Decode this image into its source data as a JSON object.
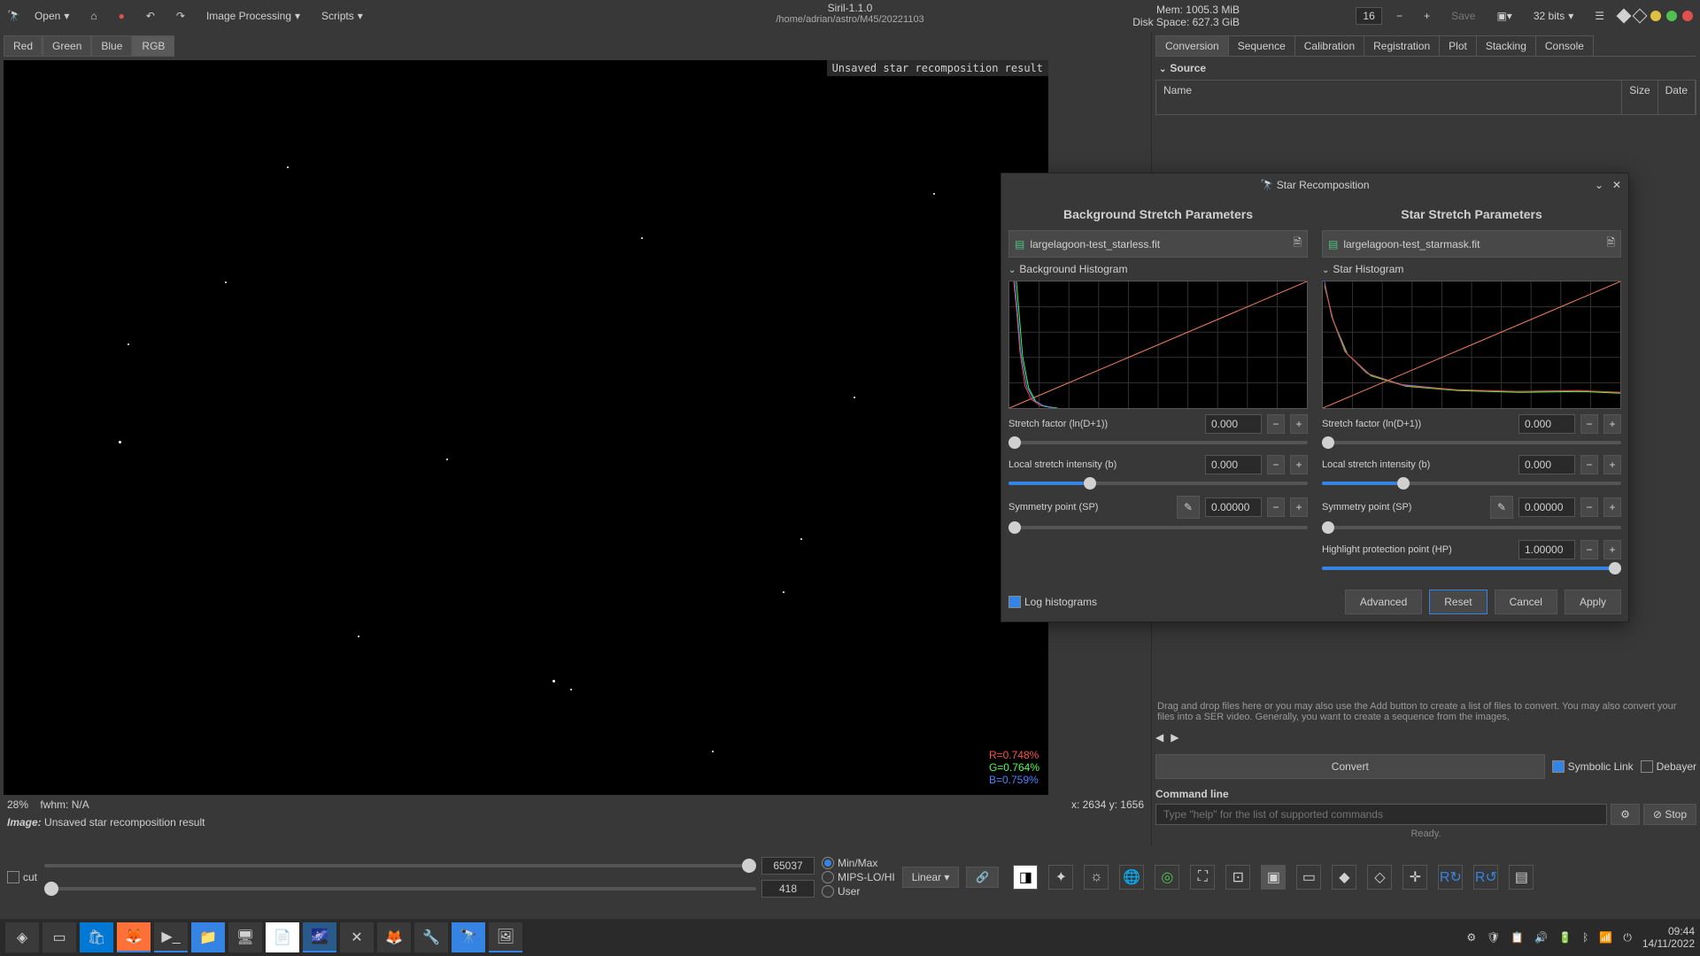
{
  "app": {
    "title": "Siril-1.1.0",
    "path": "/home/adrian/astro/M45/20221103"
  },
  "menu": {
    "open": "Open",
    "img_proc": "Image Processing",
    "scripts": "Scripts",
    "save": "Save",
    "bits": "32 bits"
  },
  "mem": {
    "line1": "Mem: 1005.3 MiB",
    "line2": "Disk Space: 627.3 GiB"
  },
  "toolbar_num": "16",
  "channels": [
    "Red",
    "Green",
    "Blue",
    "RGB"
  ],
  "channel_active": 3,
  "image_header": "Unsaved star recomposition result",
  "rgb": {
    "r": "R=0.748%",
    "g": "G=0.764%",
    "b": "B=0.759%"
  },
  "status": {
    "zoom": "28%",
    "fwhm": "fwhm:   N/A",
    "coords": "x: 2634 y: 1656"
  },
  "image_status": "Unsaved star recomposition result",
  "tabs": [
    "Conversion",
    "Sequence",
    "Calibration",
    "Registration",
    "Plot",
    "Stacking",
    "Console"
  ],
  "tab_active": 0,
  "source": {
    "label": "Source",
    "cols": [
      "Name",
      "Size",
      "Date"
    ]
  },
  "seq_hint": "Drag and drop files here or you may also use the Add button to create a list of files to convert. You may also convert your files into a SER video. Generally, you want to create a sequence from the images,",
  "convert": {
    "btn": "Convert",
    "sym": "Symbolic Link",
    "deb": "Debayer"
  },
  "cmd": {
    "label": "Command line",
    "placeholder": "Type \"help\" for the list of supported commands",
    "stop": "Stop",
    "ready": "Ready."
  },
  "bottom": {
    "cut": "cut",
    "max": "65037",
    "min": "418",
    "modes": [
      "Min/Max",
      "MIPS-LO/HI",
      "User"
    ],
    "mode_on": 0,
    "linear": "Linear"
  },
  "taskbar_time": {
    "time": "09:44",
    "date": "14/11/2022"
  },
  "dialog": {
    "title": "Star Recomposition",
    "bg_title": "Background Stretch Parameters",
    "star_title": "Star Stretch Parameters",
    "bg_file": "largelagoon-test_starless.fit",
    "star_file": "largelagoon-test_starmask.fit",
    "bg_hist": "Background Histogram",
    "star_hist": "Star Histogram",
    "stretch_factor": "Stretch factor (ln(D+1))",
    "local_intensity": "Local stretch intensity (b)",
    "symmetry": "Symmetry point (SP)",
    "highlight": "Highlight protection point (HP)",
    "v0": "0.000",
    "v0_5": "0.00000",
    "v1": "1.00000",
    "log_hist": "Log histograms",
    "advanced": "Advanced",
    "reset": "Reset",
    "cancel": "Cancel",
    "apply": "Apply"
  },
  "chart_data": [
    {
      "type": "line",
      "title": "Background Histogram",
      "xlim": [
        0,
        1
      ],
      "ylim": [
        0,
        1
      ],
      "grid": true,
      "series": [
        {
          "name": "red",
          "clipped_left": true
        },
        {
          "name": "green",
          "clipped_left": true
        },
        {
          "name": "blue",
          "clipped_left": true
        },
        {
          "name": "transfer",
          "x": [
            0,
            1
          ],
          "y": [
            0,
            1
          ]
        }
      ]
    },
    {
      "type": "line",
      "title": "Star Histogram",
      "xlim": [
        0,
        1
      ],
      "ylim": [
        0,
        1
      ],
      "grid": true,
      "series": [
        {
          "name": "red",
          "decay": "exponential"
        },
        {
          "name": "green",
          "decay": "exponential"
        },
        {
          "name": "blue",
          "decay": "exponential"
        },
        {
          "name": "transfer",
          "x": [
            0,
            1
          ],
          "y": [
            0,
            1
          ]
        }
      ]
    }
  ]
}
